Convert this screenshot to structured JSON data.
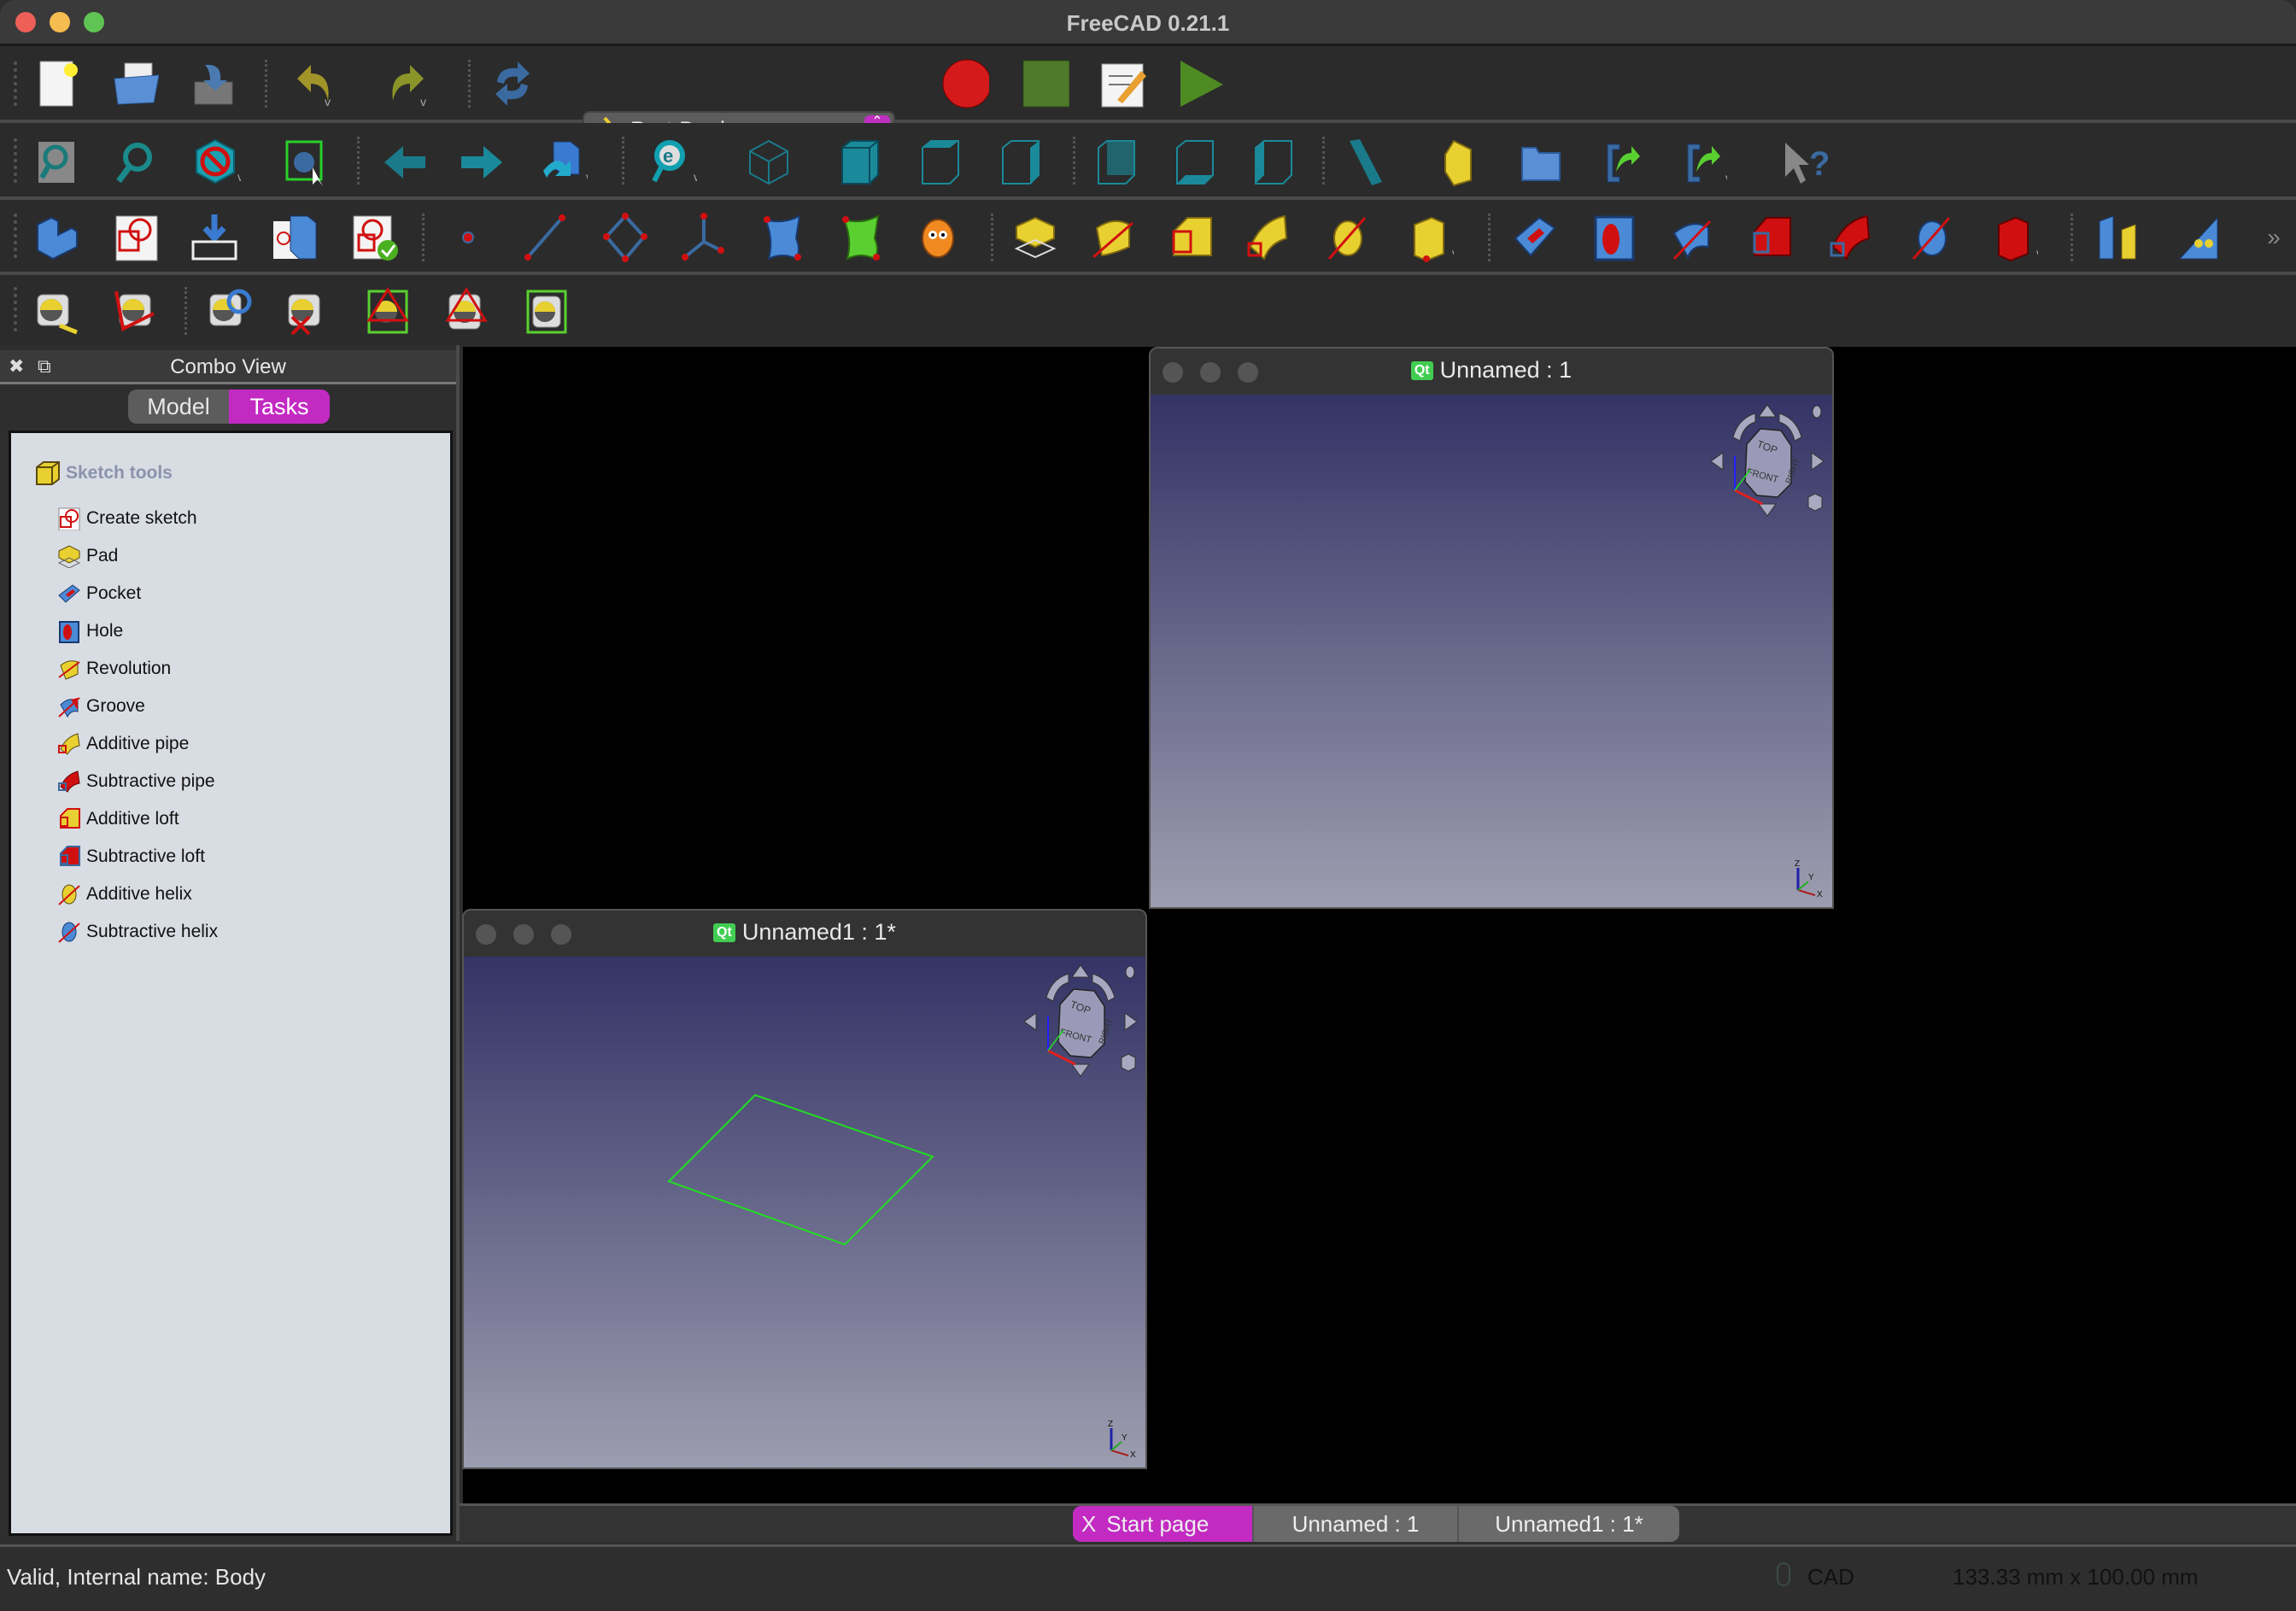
{
  "window": {
    "title": "FreeCAD 0.21.1"
  },
  "toolbar": {
    "workbench_selector": {
      "value": "Part Design"
    },
    "row1": [
      "new-document",
      "open-document",
      "save-document",
      "undo",
      "redo",
      "refresh",
      "workbench-selector",
      "macro-record",
      "macro-stop",
      "macro-edit",
      "macro-execute"
    ],
    "row2": [
      "fit-all",
      "fit-selection",
      "draw-style",
      "bounding-box",
      "view-back",
      "view-forward",
      "std-views",
      "sync-view",
      "view-isometric",
      "view-front",
      "view-top",
      "view-right",
      "view-rear",
      "view-bottom",
      "view-left",
      "measure-distance",
      "create-part",
      "create-group",
      "link",
      "link-actions",
      "whats-this"
    ],
    "row3": [
      "create-body",
      "create-sketch",
      "validate-sketch",
      "shape-binder",
      "check-geometry",
      "datum-point",
      "datum-line",
      "datum-plane",
      "local-coordinate-system",
      "shape-binder2",
      "subshape-binder",
      "clone",
      "pad",
      "revolution",
      "additive-loft",
      "additive-pipe",
      "additive-helix",
      "additive-primitive",
      "pocket",
      "hole",
      "groove",
      "subtractive-loft",
      "subtractive-pipe",
      "subtractive-helix",
      "subtractive-primitive",
      "mirrored",
      "linear-pattern"
    ],
    "row4": [
      "measure-linear",
      "measure-angular",
      "measure-refresh",
      "measure-clear",
      "measure-toggle-all",
      "measure-toggle-3d",
      "measure-toggle-delta"
    ]
  },
  "combo_view": {
    "title": "Combo View",
    "tabs": [
      {
        "label": "Model",
        "active": false
      },
      {
        "label": "Tasks",
        "active": true
      }
    ],
    "task_group": {
      "title": "Sketch tools",
      "items": [
        {
          "label": "Create sketch",
          "icon": "create-sketch-icon"
        },
        {
          "label": "Pad",
          "icon": "pad-icon"
        },
        {
          "label": "Pocket",
          "icon": "pocket-icon"
        },
        {
          "label": "Hole",
          "icon": "hole-icon"
        },
        {
          "label": "Revolution",
          "icon": "revolution-icon"
        },
        {
          "label": "Groove",
          "icon": "groove-icon"
        },
        {
          "label": "Additive pipe",
          "icon": "additive-pipe-icon"
        },
        {
          "label": "Subtractive pipe",
          "icon": "subtractive-pipe-icon"
        },
        {
          "label": "Additive loft",
          "icon": "additive-loft-icon"
        },
        {
          "label": "Subtractive loft",
          "icon": "subtractive-loft-icon"
        },
        {
          "label": "Additive helix",
          "icon": "additive-helix-icon"
        },
        {
          "label": "Subtractive helix",
          "icon": "subtractive-helix-icon"
        }
      ]
    }
  },
  "views": [
    {
      "title": "Unnamed : 1",
      "badge": "Qt",
      "navcube": {
        "top": "TOP",
        "front": "FRONT",
        "right": "RIGHT"
      },
      "axes": [
        "X",
        "Y",
        "Z"
      ]
    },
    {
      "title": "Unnamed1 : 1*",
      "badge": "Qt",
      "navcube": {
        "top": "TOP",
        "front": "FRONT",
        "right": "RIGHT"
      },
      "axes": [
        "X",
        "Y",
        "Z"
      ]
    }
  ],
  "document_tabs": [
    {
      "label": "Start page",
      "active": true,
      "close": "X"
    },
    {
      "label": "Unnamed : 1",
      "active": false
    },
    {
      "label": "Unnamed1 : 1*",
      "active": false
    }
  ],
  "status_bar": {
    "message": "Valid, Internal name: Body",
    "nav_style": "CAD",
    "dimensions": "133.33 mm x 100.00 mm"
  },
  "colors": {
    "accent": "#c030c0",
    "sketch_line": "#22dd22",
    "viewport_top": "#333366",
    "viewport_bottom": "#9d9db0"
  }
}
